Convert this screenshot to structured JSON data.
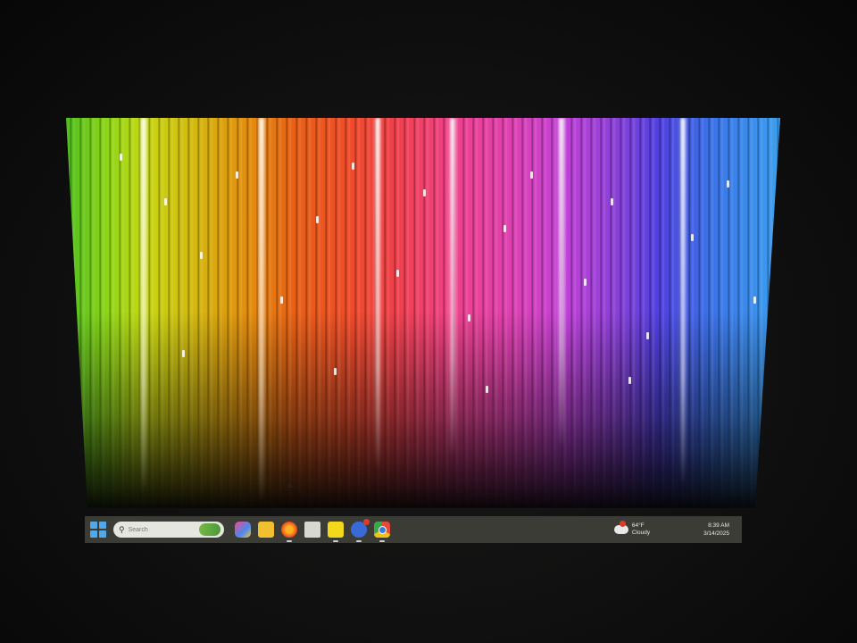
{
  "taskbar": {
    "search": {
      "placeholder": "Search"
    },
    "pinned_apps": [
      {
        "icon": "copilot-icon"
      },
      {
        "icon": "folder-icon"
      },
      {
        "icon": "firefox-icon"
      },
      {
        "icon": "mail-icon"
      },
      {
        "icon": "sticky-notes-icon"
      },
      {
        "icon": "power-icon"
      },
      {
        "icon": "chrome-icon"
      }
    ],
    "weather": {
      "temperature": "64°F",
      "condition": "Cloudy"
    },
    "clock": {
      "time": "8:39 AM",
      "date": "3/14/2025"
    }
  },
  "colors": {
    "taskbar_bg": "#3b3c36",
    "start_blue": "#52a8e8",
    "badge_red": "#e03a2a"
  }
}
